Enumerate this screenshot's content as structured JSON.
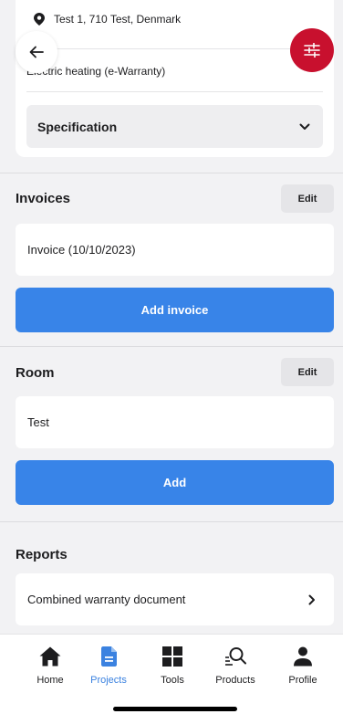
{
  "header": {
    "address": "Test 1, 710 Test, Denmark",
    "product": "Electric heating (e-Warranty)",
    "specification_label": "Specification"
  },
  "invoices": {
    "title": "Invoices",
    "edit_label": "Edit",
    "items": [
      "Invoice (10/10/2023)"
    ],
    "add_label": "Add invoice"
  },
  "room": {
    "title": "Room",
    "edit_label": "Edit",
    "items": [
      "Test"
    ],
    "add_label": "Add"
  },
  "reports": {
    "title": "Reports",
    "items": [
      "Combined warranty document"
    ]
  },
  "tabbar": {
    "tabs": [
      {
        "label": "Home",
        "icon": "home-icon"
      },
      {
        "label": "Projects",
        "icon": "document-icon"
      },
      {
        "label": "Tools",
        "icon": "grid-icon"
      },
      {
        "label": "Products",
        "icon": "search-icon"
      },
      {
        "label": "Profile",
        "icon": "user-icon"
      }
    ],
    "active": "Projects"
  },
  "colors": {
    "accent": "#3884e8",
    "filter_button": "#c8102e",
    "active_tab": "#3b82e0"
  }
}
